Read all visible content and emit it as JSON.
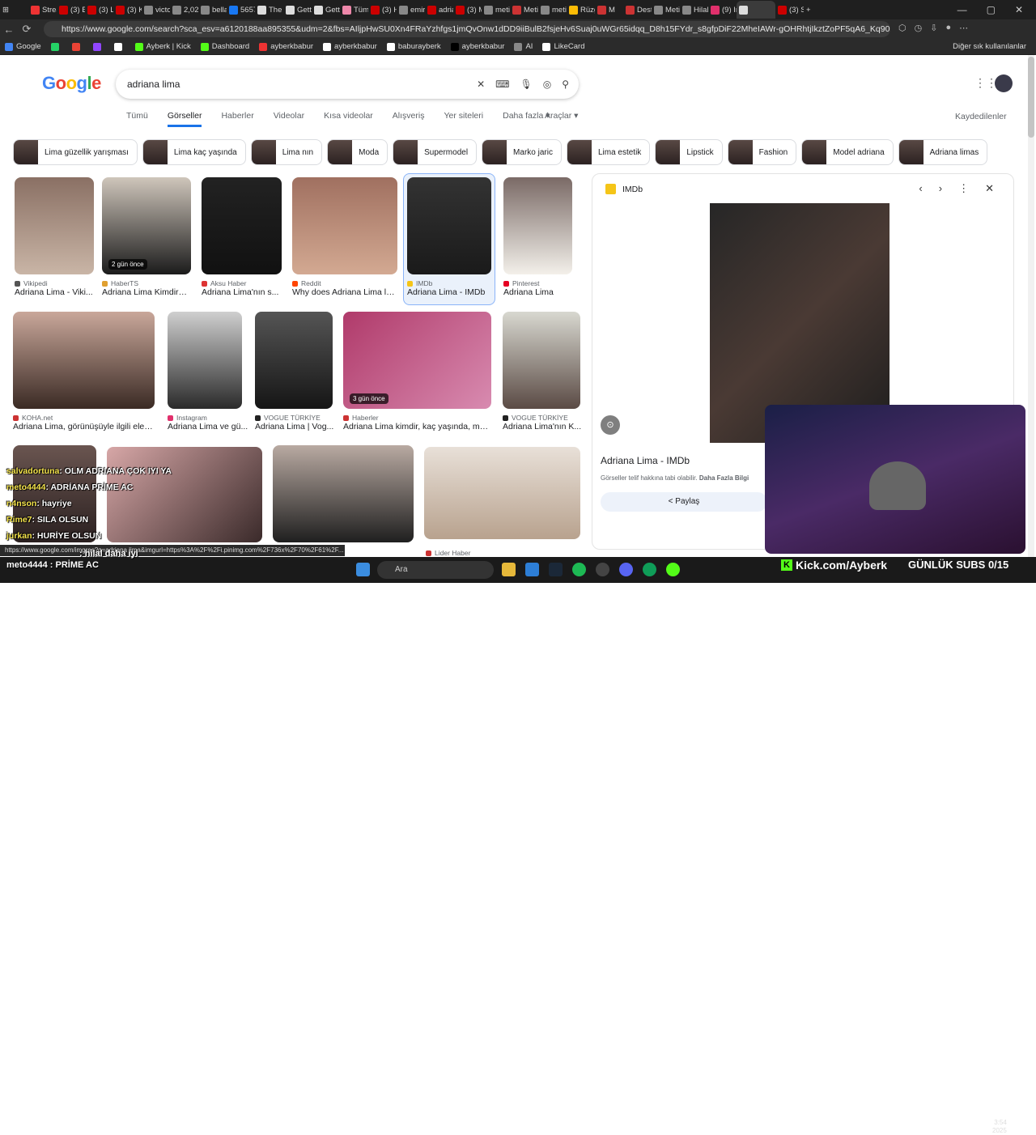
{
  "browser": {
    "tabs": [
      "Strea",
      "(3) B",
      "(3) Li",
      "(3) K",
      "victo",
      "2,021",
      "bella",
      "5657",
      "The",
      "Getti",
      "Getti",
      "Tüm",
      "(3) H",
      "emir",
      "adria",
      "(3) M",
      "meti",
      "Meti",
      "meti",
      "Rüzg",
      "M",
      "Dest",
      "Meti",
      "Hilal",
      "(9) Ir",
      "",
      "(3) S"
    ],
    "url": "https://www.google.com/search?sca_esv=a6120188aa895355&udm=2&fbs=AIljpHwSU0Xn4FRaYzhfgs1jmQvOnw1dDD9iiBulB2fsjeHv6Suaj0uWGr65idqq_D8h15FYdr_s8gfpDiF22MheIAWr-gOHRhtjIkztZoPF5qA6_Kq90Icqd9D9DN63zZ0mWEI3...",
    "bookmarks": [
      "Google",
      "",
      "",
      "",
      "",
      "Ayberk | Kick",
      "Dashboard",
      "ayberkbabur",
      "ayberkbabur",
      "baburayberk",
      "ayberkbabur",
      "AI",
      "LikeCard"
    ],
    "bookmarks_other": "Diğer sık kullanılanlar"
  },
  "google": {
    "logo": "Google",
    "query": "adriana lima",
    "tabs": [
      "Tümü",
      "Görseller",
      "Haberler",
      "Videolar",
      "Kısa videolar",
      "Alışveriş",
      "Yer siteleri",
      "Daha fazla ▾"
    ],
    "tools": "Araçlar ▾",
    "saved": "Kaydedilenler",
    "chips": [
      "Lima güzellik yarışması",
      "Lima kaç yaşında",
      "Lima nın",
      "Moda",
      "Supermodel",
      "Marko jaric",
      "Lima estetik",
      "Lipstick",
      "Fashion",
      "Model adriana",
      "Adriana limas"
    ]
  },
  "results_row1": [
    {
      "source": "Vikipedi",
      "title": "Adriana Lima - Viki...",
      "badge": ""
    },
    {
      "source": "HaberTS",
      "title": "Adriana Lima Kimdir? ...",
      "badge": "2 gün önce"
    },
    {
      "source": "Aksu Haber",
      "title": "Adriana Lima'nın s...",
      "badge": ""
    },
    {
      "source": "Reddit",
      "title": "Why does Adriana Lima lo...",
      "badge": ""
    },
    {
      "source": "IMDb",
      "title": "Adriana Lima - IMDb",
      "badge": ""
    },
    {
      "source": "Pinterest",
      "title": "Adriana Lima",
      "badge": ""
    }
  ],
  "results_row2": [
    {
      "source": "KOHA.net",
      "title": "Adriana Lima, görünüşüyle ilgili eleşti...",
      "badge": ""
    },
    {
      "source": "Instagram",
      "title": "Adriana Lima ve gü...",
      "badge": ""
    },
    {
      "source": "VOGUE TÜRKİYE",
      "title": "Adriana Lima | Vog...",
      "badge": ""
    },
    {
      "source": "Haberler",
      "title": "Adriana Lima kimdir, kaç yaşında, man...",
      "badge": "3 gün önce"
    },
    {
      "source": "VOGUE TÜRKİYE",
      "title": "Adriana Lima'nın K...",
      "badge": ""
    }
  ],
  "results_row3_source": "Lider Haber",
  "panel": {
    "site": "IMDb",
    "title": "Adriana Lima - IMDb",
    "copyright": "Görseller telif hakkına tabi olabilir.",
    "more_info": "Daha Fazla Bilgi",
    "share": "Paylaş"
  },
  "chat": [
    {
      "user": "salvadortuna",
      "msg": ": OLM ADRIANA ÇOK IYI YA"
    },
    {
      "user": "meto4444",
      "msg": ": ADRİANA PRİME AC"
    },
    {
      "user": "n4nson",
      "msg": ": hayriye"
    },
    {
      "user": "Rime7",
      "msg": ": SILA OLSUN"
    },
    {
      "user": "jurkan",
      "msg": ": HURİYE OLSUN"
    }
  ],
  "status_url": "https://www.google.com/imgres?q=adriana lima&imgurl=https%3A%2F%2Fi.pinimg.com%2F736x%2F70%2F61%2F...",
  "ticker": "meto4444 : PRİME AC",
  "ticker_top": ": hilal daha iyi",
  "taskbar": {
    "search": "Ara",
    "clock": "3:54",
    "year": "2025"
  },
  "overlay": {
    "kick": "Kick.com/Ayberk",
    "subs": "GÜNLÜK SUBS 0/15"
  }
}
